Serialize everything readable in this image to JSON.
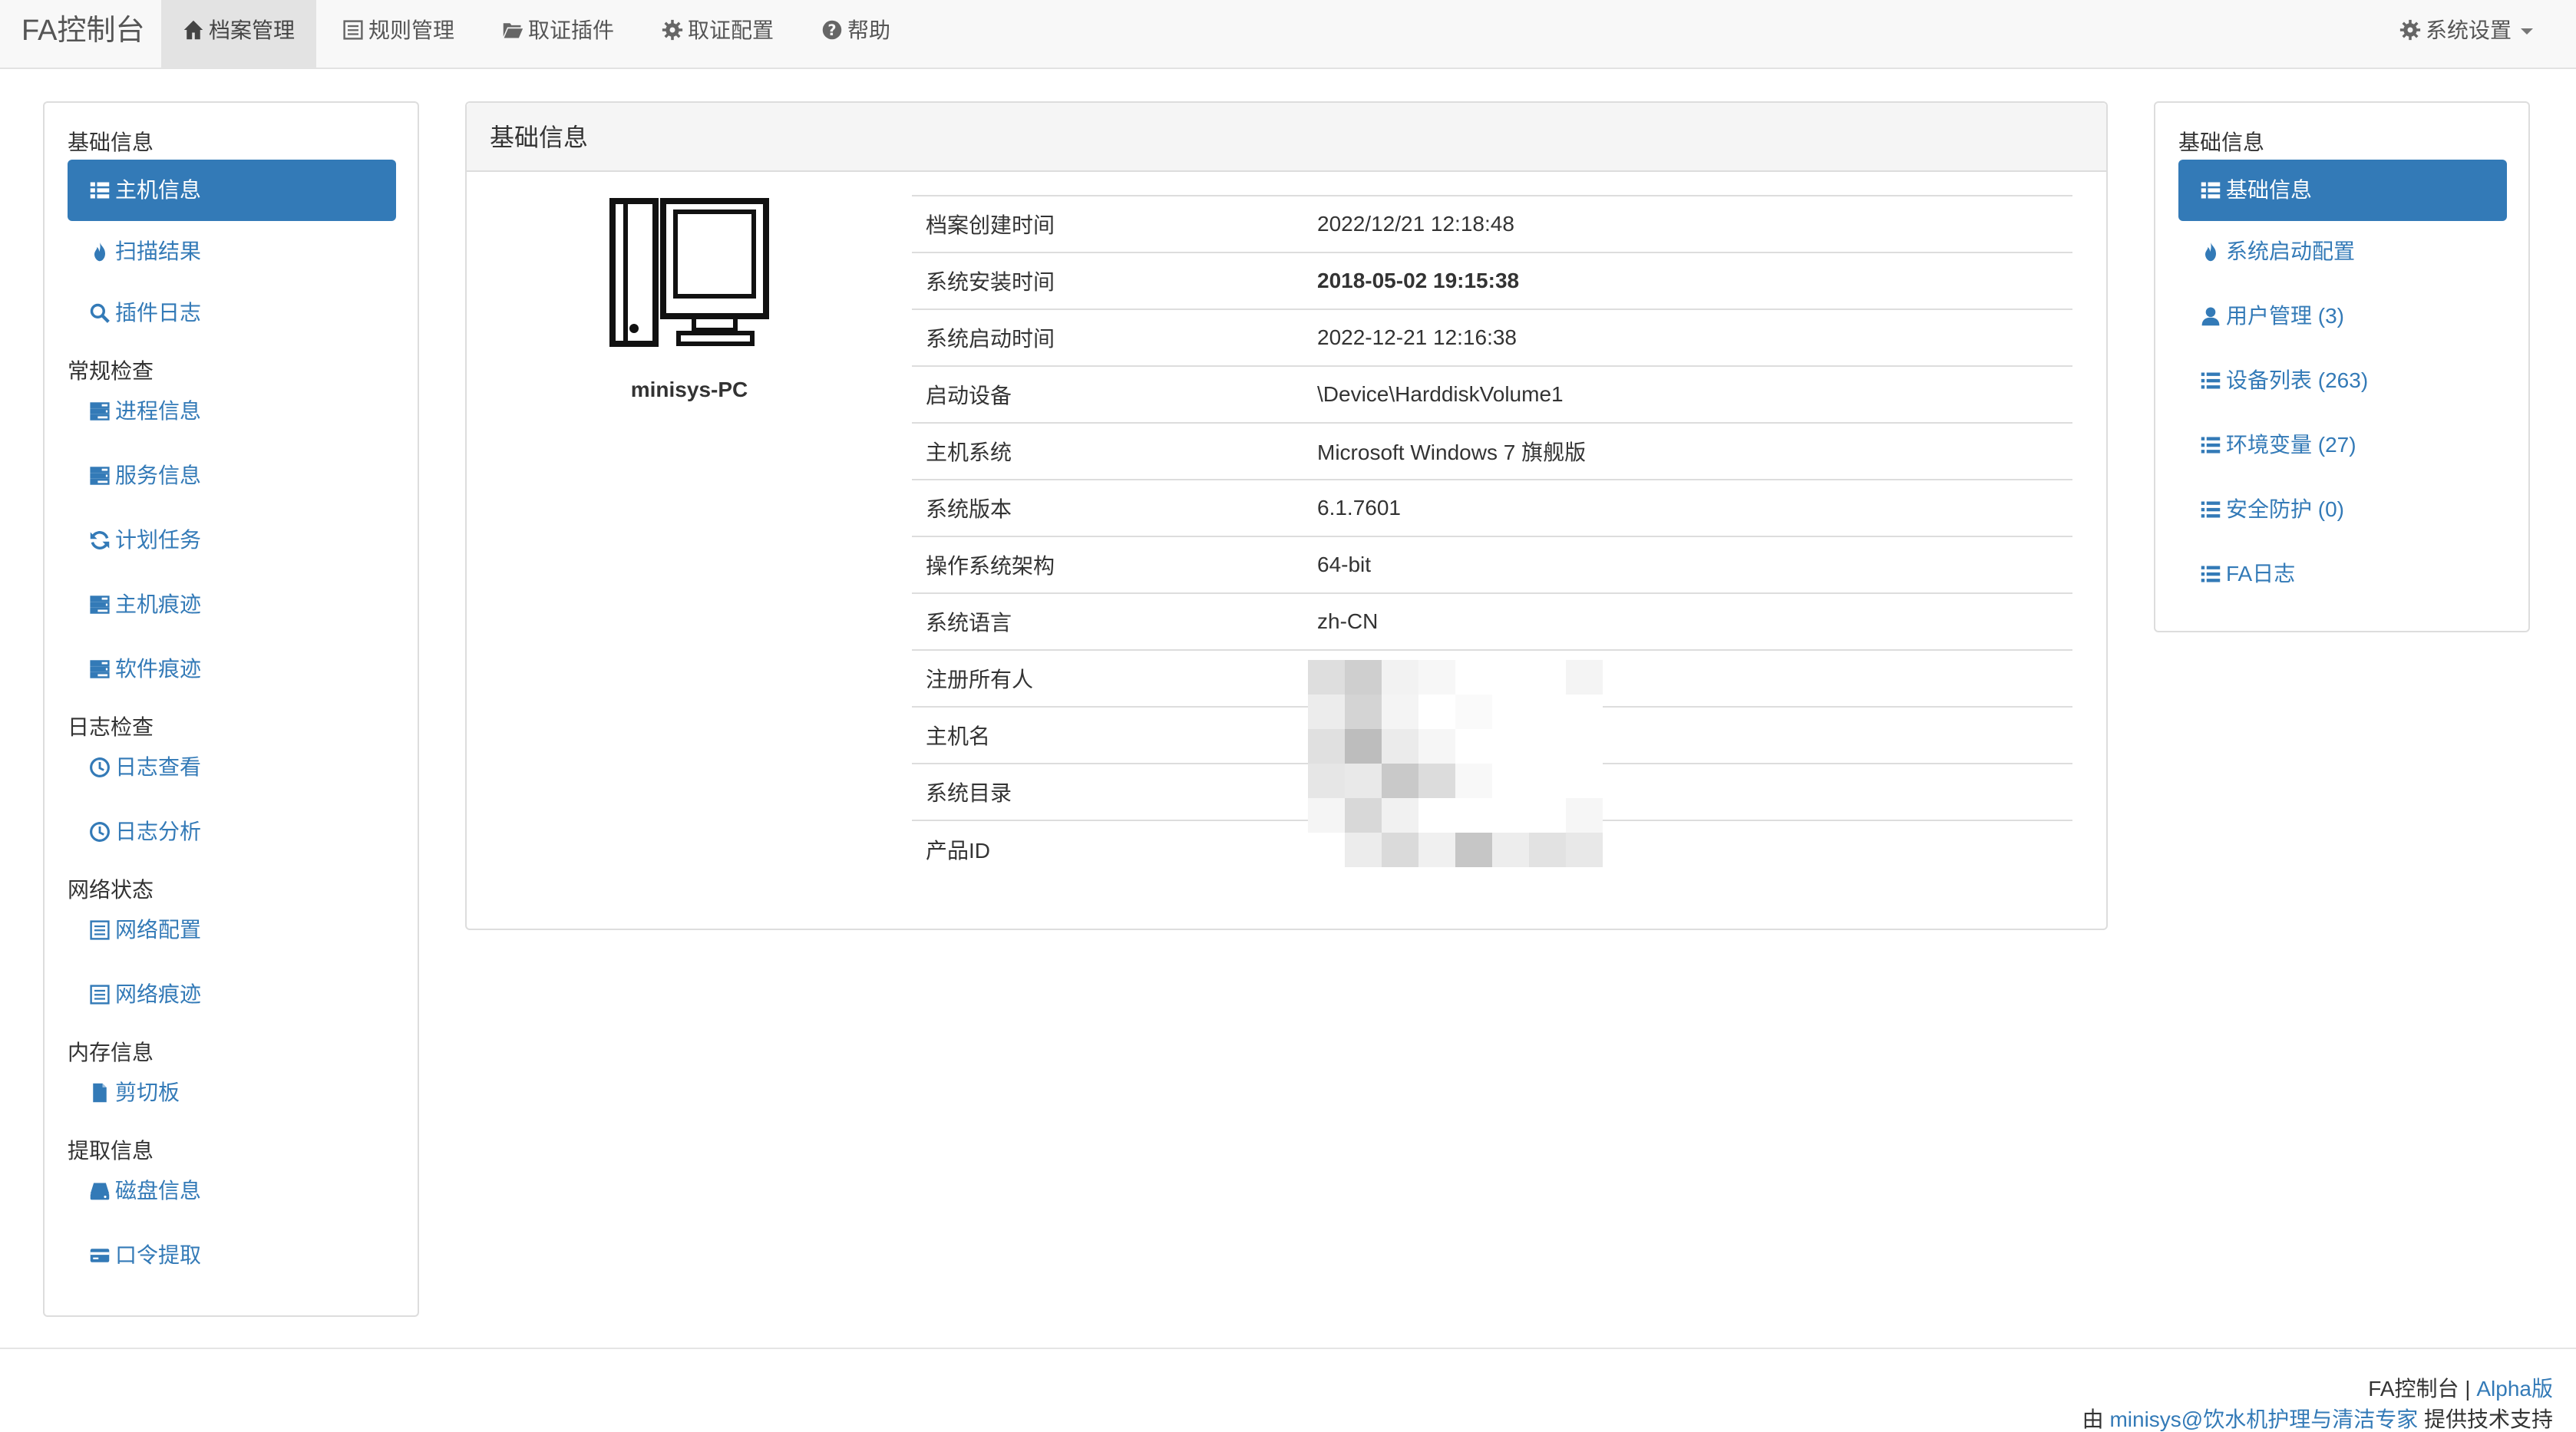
{
  "navbar": {
    "brand": "FA控制台",
    "items": [
      {
        "label": "档案管理",
        "icon": "home-icon",
        "active": true
      },
      {
        "label": "规则管理",
        "icon": "list-alt-icon"
      },
      {
        "label": "取证插件",
        "icon": "folder-open-icon"
      },
      {
        "label": "取证配置",
        "icon": "gear-icon"
      },
      {
        "label": "帮助",
        "icon": "question-circle-icon"
      }
    ],
    "settings_label": "系统设置"
  },
  "left_sidebar": {
    "groups": [
      {
        "title": "基础信息",
        "items": [
          {
            "label": "主机信息",
            "icon": "th-list-icon",
            "active": true
          },
          {
            "label": "扫描结果",
            "icon": "fire-icon"
          },
          {
            "label": "插件日志",
            "icon": "search-icon"
          }
        ]
      },
      {
        "title": "常规检查",
        "items": [
          {
            "label": "进程信息",
            "icon": "tasks-icon"
          },
          {
            "label": "服务信息",
            "icon": "tasks-icon"
          },
          {
            "label": "计划任务",
            "icon": "refresh-icon"
          },
          {
            "label": "主机痕迹",
            "icon": "tasks-icon"
          },
          {
            "label": "软件痕迹",
            "icon": "tasks-icon"
          }
        ]
      },
      {
        "title": "日志检查",
        "items": [
          {
            "label": "日志查看",
            "icon": "clock-icon"
          },
          {
            "label": "日志分析",
            "icon": "clock-icon"
          }
        ]
      },
      {
        "title": "网络状态",
        "items": [
          {
            "label": "网络配置",
            "icon": "list-alt-icon"
          },
          {
            "label": "网络痕迹",
            "icon": "list-alt-icon"
          }
        ]
      },
      {
        "title": "内存信息",
        "items": [
          {
            "label": "剪切板",
            "icon": "file-icon"
          }
        ]
      },
      {
        "title": "提取信息",
        "items": [
          {
            "label": "磁盘信息",
            "icon": "hdd-icon"
          },
          {
            "label": "口令提取",
            "icon": "credit-card-icon"
          }
        ]
      }
    ]
  },
  "main": {
    "panel_title": "基础信息",
    "hostname": "minisys-PC",
    "rows": [
      {
        "key": "档案创建时间",
        "value": "2022/12/21 12:18:48",
        "bold": false
      },
      {
        "key": "系统安装时间",
        "value": "2018-05-02 19:15:38",
        "bold": true
      },
      {
        "key": "系统启动时间",
        "value": "2022-12-21 12:16:38",
        "bold": false
      },
      {
        "key": "启动设备",
        "value": "\\Device\\HarddiskVolume1",
        "bold": false
      },
      {
        "key": "主机系统",
        "value": "Microsoft Windows 7 旗舰版",
        "bold": false
      },
      {
        "key": "系统版本",
        "value": "6.1.7601",
        "bold": false
      },
      {
        "key": "操作系统架构",
        "value": "64-bit",
        "bold": false
      },
      {
        "key": "系统语言",
        "value": "zh-CN",
        "bold": false
      },
      {
        "key": "注册所有人",
        "value": "",
        "bold": false
      },
      {
        "key": "主机名",
        "value": "",
        "bold": false
      },
      {
        "key": "系统目录",
        "value": "",
        "bold": false
      },
      {
        "key": "产品ID",
        "value": "",
        "bold": false
      }
    ]
  },
  "right_sidebar": {
    "title": "基础信息",
    "items": [
      {
        "label": "基础信息",
        "icon": "th-list-icon",
        "active": true
      },
      {
        "label": "系统启动配置",
        "icon": "fire-icon"
      },
      {
        "label": "用户管理 (3)",
        "icon": "user-icon"
      },
      {
        "label": "设备列表 (263)",
        "icon": "list-icon"
      },
      {
        "label": "环境变量 (27)",
        "icon": "list-icon"
      },
      {
        "label": "安全防护 (0)",
        "icon": "list-icon"
      },
      {
        "label": "FA日志",
        "icon": "list-icon"
      }
    ]
  },
  "footer": {
    "line1_prefix": "FA控制台 | ",
    "line1_link": "Alpha版",
    "line2_prefix": "由 ",
    "line2_link": "minisys@饮水机护理与清洁专家",
    "line2_suffix": " 提供技术支持"
  },
  "colors": {
    "accent": "#337ab7",
    "navbar_bg": "#f8f8f8",
    "active_nav_bg": "#e3e3e3"
  }
}
